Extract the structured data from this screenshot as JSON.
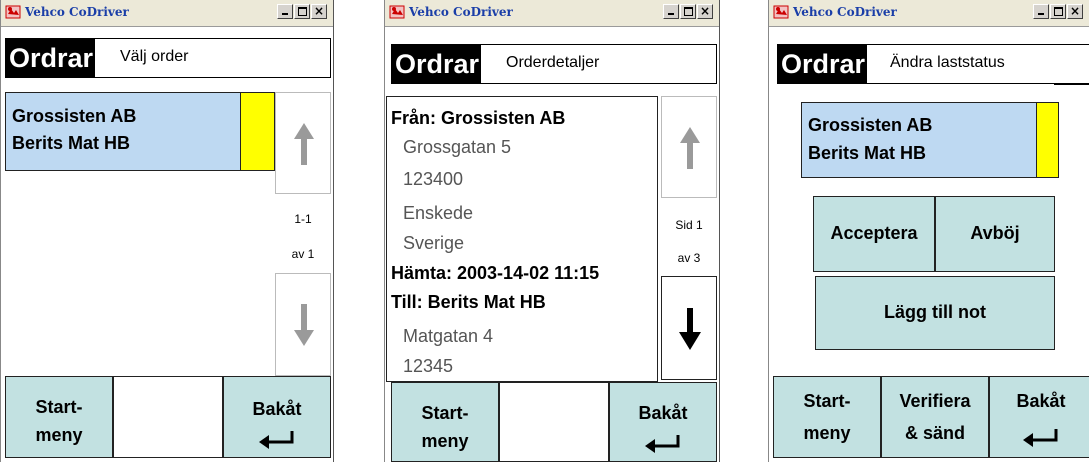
{
  "app_title": "Vehco CoDriver",
  "header_title": "Ordrar",
  "close_glyph": "×",
  "screen1": {
    "subtitle": "Välj order",
    "order": {
      "line1": "Grossisten AB",
      "line2": "Berits Mat HB",
      "status_color": "#ffff00"
    },
    "pager": {
      "range": "1-1",
      "total": "av 1"
    },
    "buttons": {
      "start_line1": "Start-",
      "start_line2": "meny",
      "back": "Bakåt"
    }
  },
  "screen2": {
    "subtitle": "Orderdetaljer",
    "details": [
      {
        "text": "Från: Grossisten AB",
        "style": "b"
      },
      {
        "text": "Grossgatan 5",
        "style": "n"
      },
      {
        "text": "123400",
        "style": "n"
      },
      {
        "text": "Enskede",
        "style": "n"
      },
      {
        "text": "Sverige",
        "style": "n"
      },
      {
        "text": "Hämta: 2003-14-02 11:15",
        "style": "b"
      },
      {
        "text": "Till: Berits Mat HB",
        "style": "b"
      },
      {
        "text": "Matgatan 4",
        "style": "n"
      },
      {
        "text": "12345",
        "style": "n"
      }
    ],
    "pager": {
      "page": "Sid 1",
      "total": "av 3"
    },
    "buttons": {
      "start_line1": "Start-",
      "start_line2": "meny",
      "back": "Bakåt"
    }
  },
  "screen3": {
    "subtitle": "Ändra laststatus",
    "order": {
      "line1": "Grossisten AB",
      "line2": "Berits Mat HB",
      "status_color": "#ffff00"
    },
    "actions": {
      "accept": "Acceptera",
      "reject": "Avböj",
      "add_note": "Lägg till not"
    },
    "buttons": {
      "start_line1": "Start-",
      "start_line2": "meny",
      "verify_line1": "Verifiera",
      "verify_line2": "& sänd",
      "back": "Bakåt"
    }
  }
}
